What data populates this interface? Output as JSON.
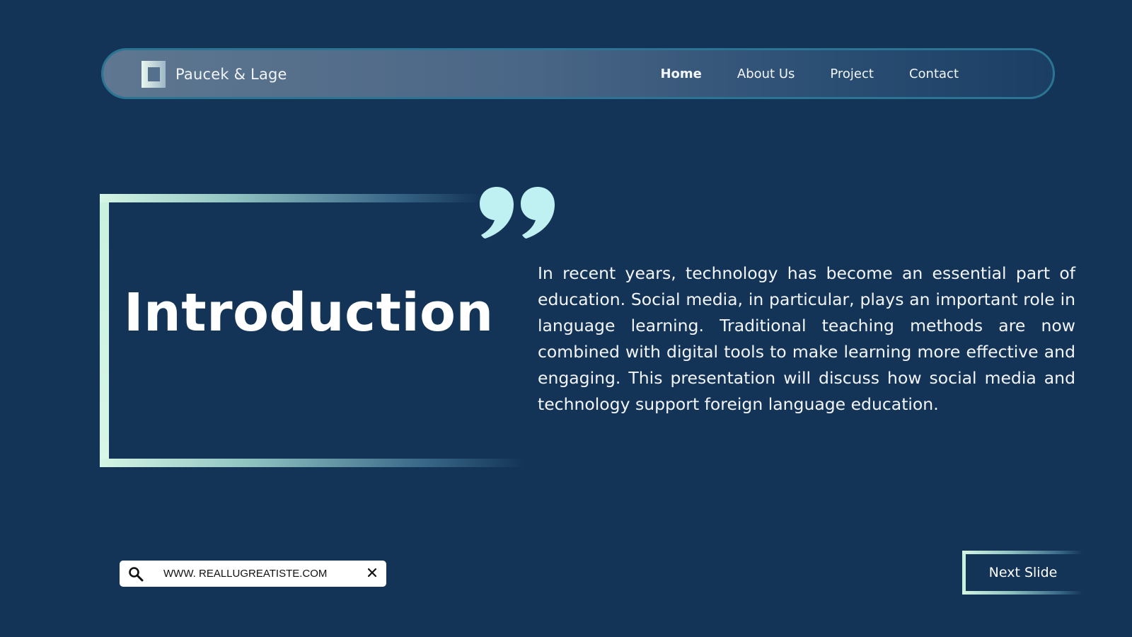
{
  "navbar": {
    "brand_name": "Paucek & Lage",
    "links": [
      {
        "label": "Home",
        "active": true
      },
      {
        "label": "About Us",
        "active": false
      },
      {
        "label": "Project",
        "active": false
      },
      {
        "label": "Contact",
        "active": false
      }
    ]
  },
  "intro": {
    "title": "Introduction",
    "body": "In recent years, technology has become an essential part of education. Social media, in particular, plays an important role in language learning. Traditional teaching methods are now combined with digital tools to make learning more effective and engaging. This presentation will discuss how social media and technology support foreign language education."
  },
  "search": {
    "value": "WWW. REALLUGREATISTE.COM",
    "search_icon": "search-icon",
    "clear_icon": "close-icon"
  },
  "next_button": {
    "label": "Next Slide"
  },
  "colors": {
    "background": "#133457",
    "accent_mint": "#c9f0de",
    "quote_color": "#bff0f2",
    "navbar_border": "#2b7493"
  }
}
